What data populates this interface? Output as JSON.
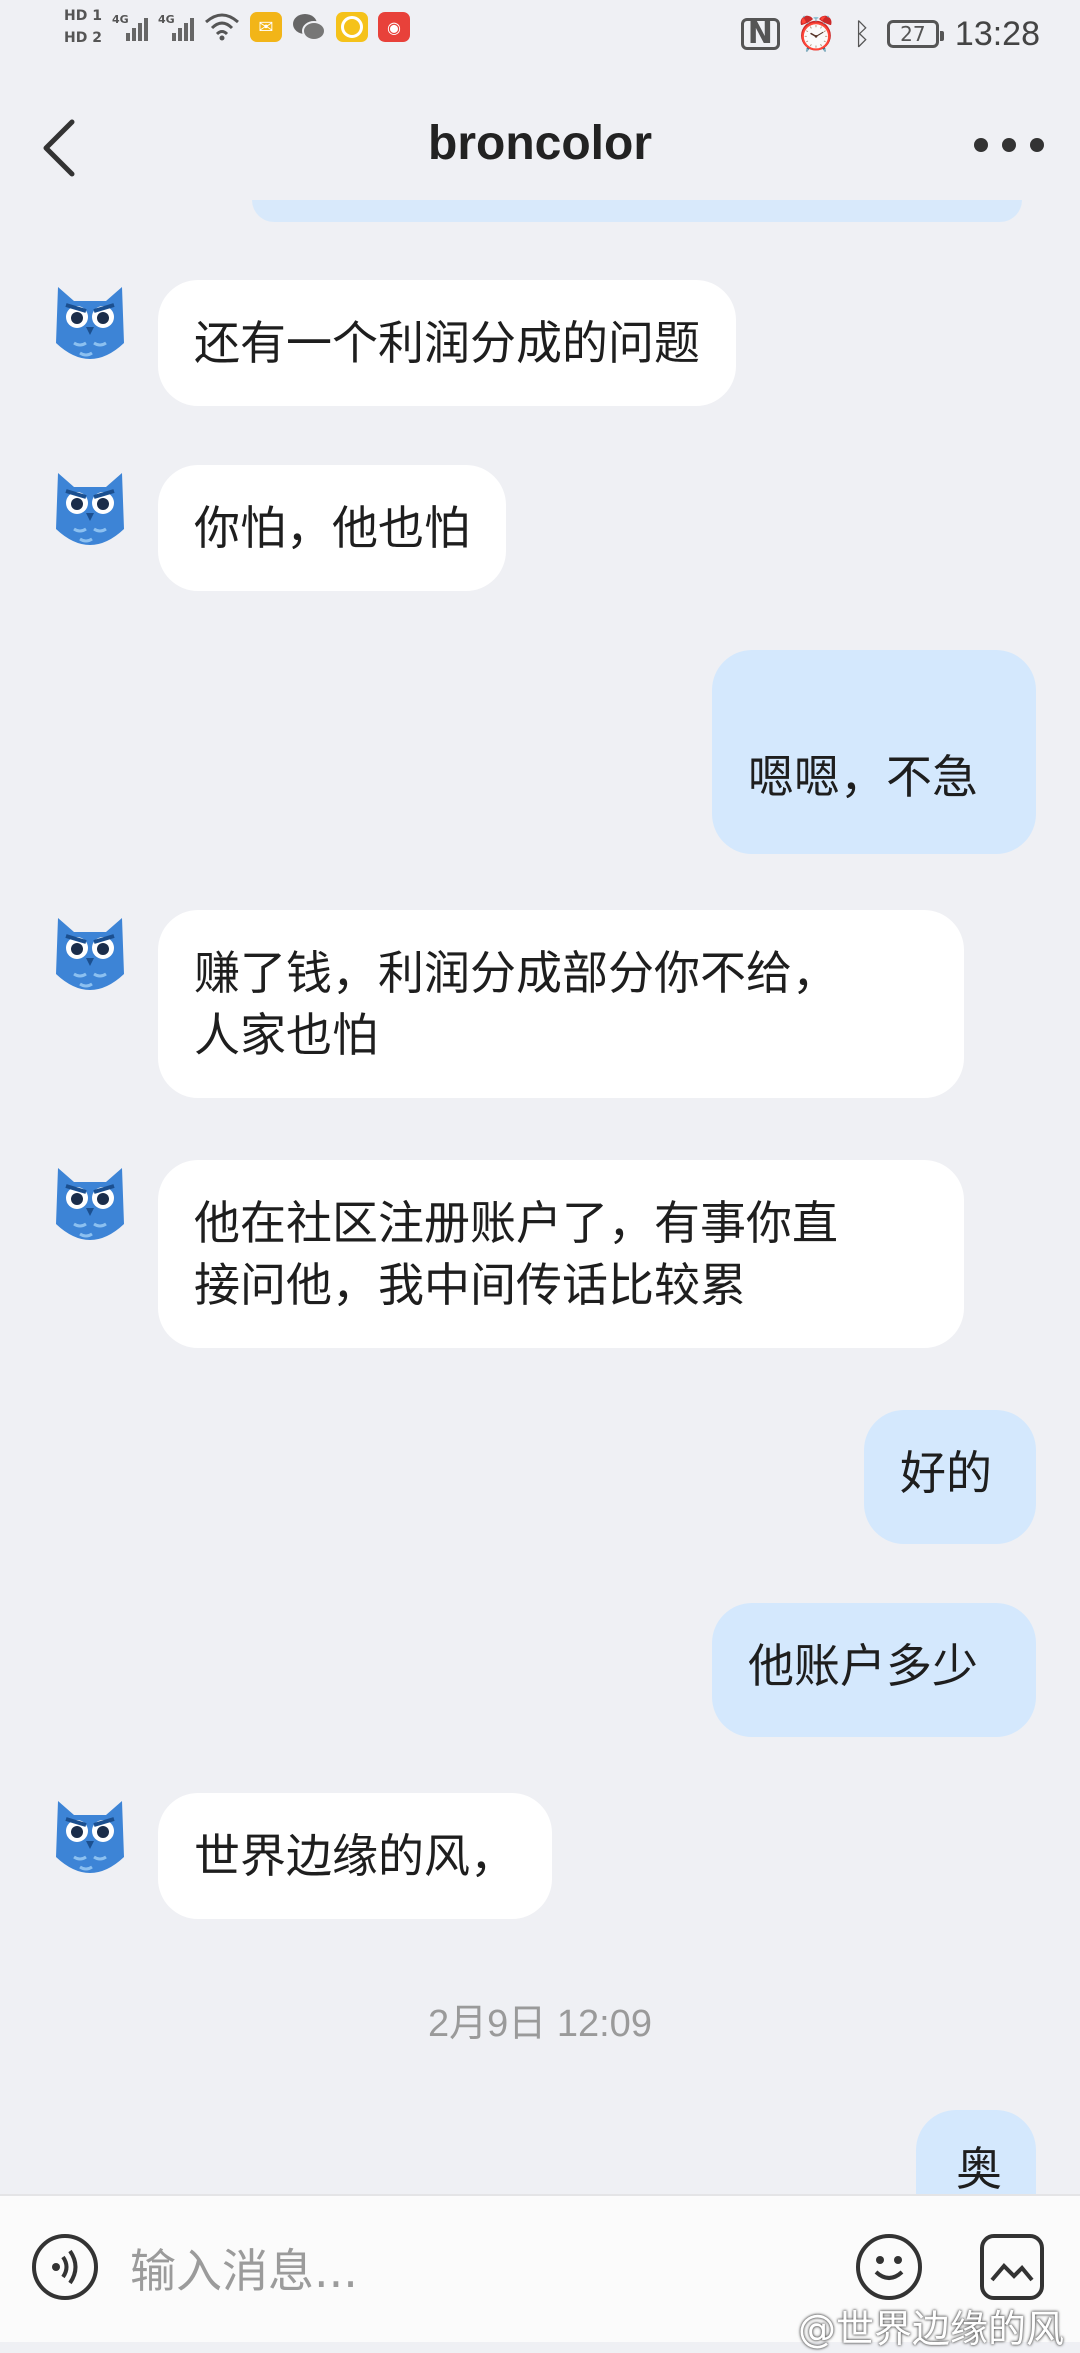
{
  "statusbar": {
    "sim1": "HD 1",
    "sim2": "HD 2",
    "network1": "4G",
    "network2": "4G",
    "battery": "27",
    "time": "13:28",
    "icons": [
      "wifi-icon",
      "email-icon",
      "wechat-icon",
      "app-icon",
      "weibo-icon",
      "nfc-icon",
      "alarm-icon",
      "bluetooth-icon"
    ]
  },
  "header": {
    "title": "broncolor",
    "back_icon": "chevron-left-icon",
    "more_icon": "more-dots-icon"
  },
  "messages": [
    {
      "from": "other",
      "text": "还有一个利润分成的问题"
    },
    {
      "from": "other",
      "text": "你怕，他也怕"
    },
    {
      "from": "me",
      "text": "嗯嗯，不急"
    },
    {
      "from": "other",
      "text": "赚了钱，利润分成部分你不给，\n人家也怕"
    },
    {
      "from": "other",
      "text": "他在社区注册账户了，有事你直\n接问他，我中间传话比较累"
    },
    {
      "from": "me",
      "text": "好的"
    },
    {
      "from": "me",
      "text": "他账户多少"
    },
    {
      "from": "other",
      "text": "世界边缘的风，"
    },
    {
      "from": "timestamp",
      "text": "2月9日 12:09"
    },
    {
      "from": "me",
      "text": "奥"
    }
  ],
  "input": {
    "placeholder": "输入消息..."
  },
  "watermark": "@世界边缘的风",
  "colors": {
    "background": "#eff0f4",
    "incoming_bubble": "#ffffff",
    "outgoing_bubble": "#d4e8fd",
    "avatar": "#3d84d6"
  }
}
